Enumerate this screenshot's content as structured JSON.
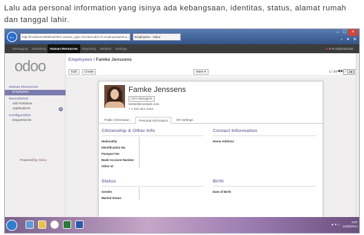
{
  "caption": "Lalu ada personal information yang isinya ada kebangsaan, identitas, status, alamat rumah dan tanggal lahir.",
  "browser": {
    "url": "http://localhost:8069/web#id=1&view_type=form&model=hr.employee&menu_id=...",
    "tab_title": "Employees - Odoo",
    "colors": {
      "chrome": "#34548a",
      "close": "#c9473a"
    }
  },
  "topbar": {
    "menu": [
      "Messaging",
      "Marketing",
      "Human Resources",
      "Reporting",
      "Website",
      "Settings"
    ],
    "active_index": 2,
    "user": "Administrator"
  },
  "sidebar": {
    "logo": "odoo",
    "sections": [
      {
        "title": "Human Resources",
        "items": [
          {
            "label": "Employees",
            "selected": true
          }
        ]
      },
      {
        "title": "Recruitment",
        "items": [
          {
            "label": "Job Positions",
            "selected": false
          },
          {
            "label": "Applications",
            "selected": false,
            "badge": "5"
          }
        ]
      },
      {
        "title": "Configuration",
        "items": [
          {
            "label": "Departments",
            "selected": false
          }
        ]
      }
    ],
    "powered_prefix": "Powered by",
    "powered_brand": "Odoo"
  },
  "header": {
    "breadcrumb_parent": "Employees",
    "breadcrumb_sep": " / ",
    "breadcrumb_current": "Famke Jenssens",
    "edit_label": "Edit",
    "create_label": "Create",
    "more_label": "More ▾",
    "pager": "1 / 20"
  },
  "employee": {
    "name": "Famke Jenssens",
    "job": "CEO Managers",
    "email": "famke@example.com",
    "phone": "+ 1 321 321 1234",
    "tabs": [
      "Public Information",
      "Personal Information",
      "HR Settings"
    ],
    "active_tab": 1
  },
  "form": {
    "citizenship_title": "Citizenship & Other Info",
    "citizenship_fields": [
      "Nationality",
      "Identification No",
      "Passport No",
      "Bank Account Number",
      "Other Id"
    ],
    "contact_title": "Contact Information",
    "contact_fields": [
      "Home Address"
    ],
    "status_title": "Status",
    "status_fields": [
      "Gender",
      "Marital Status"
    ],
    "birth_title": "Birth",
    "birth_fields": [
      "Date of Birth"
    ]
  },
  "taskbar": {
    "time": "9:07",
    "date": "11/05/2014"
  },
  "accent": "#7c7bad"
}
